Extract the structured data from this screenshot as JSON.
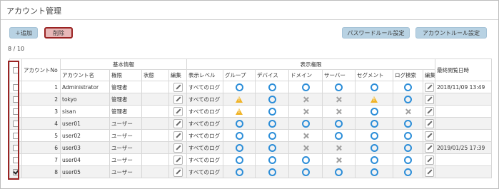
{
  "page": {
    "title": "アカウント管理"
  },
  "toolbar": {
    "add_label": "＋追加",
    "delete_label": "削除",
    "password_rule_label": "パスワードルール設定",
    "account_rule_label": "アカウントルール設定"
  },
  "selection_count": "8 / 10",
  "table": {
    "group_headers": {
      "account_no": "アカウントNo",
      "basic_info": "基本情報",
      "display_types": "表示権限",
      "last_viewed": "最終閲覧日時"
    },
    "columns": {
      "account_name": "アカウント名",
      "type": "権限",
      "status": "状態",
      "edit": "編集",
      "display_level": "表示レベル",
      "group": "グループ",
      "device": "デバイス",
      "domain": "ドメイン",
      "server": "サーバー",
      "segment": "セグメント",
      "log_search": "ログ検索",
      "edit2": "編集"
    },
    "rows": [
      {
        "no": "1",
        "name": "Administrator",
        "type": "管理者",
        "status": "",
        "level": "すべてのログ",
        "group": "circle",
        "device": "circle",
        "domain": "circle",
        "server": "circle",
        "segment": "circle",
        "log_search": "circle",
        "last_viewed": "2018/11/09 13:49",
        "checked": false
      },
      {
        "no": "2",
        "name": "tokyo",
        "type": "管理者",
        "status": "",
        "level": "すべてのログ",
        "group": "warn",
        "device": "circle",
        "domain": "cross",
        "server": "cross",
        "segment": "warn",
        "log_search": "circle",
        "last_viewed": "",
        "checked": false
      },
      {
        "no": "3",
        "name": "sisan",
        "type": "管理者",
        "status": "",
        "level": "すべてのログ",
        "group": "warn",
        "device": "circle",
        "domain": "cross",
        "server": "cross",
        "segment": "circle",
        "log_search": "cross",
        "last_viewed": "",
        "checked": false
      },
      {
        "no": "4",
        "name": "user01",
        "type": "ユーザー",
        "status": "",
        "level": "すべてのログ",
        "group": "circle",
        "device": "circle",
        "domain": "circle",
        "server": "circle",
        "segment": "circle",
        "log_search": "circle",
        "last_viewed": "",
        "checked": false
      },
      {
        "no": "5",
        "name": "user02",
        "type": "ユーザー",
        "status": "",
        "level": "すべてのログ",
        "group": "circle",
        "device": "circle",
        "domain": "cross",
        "server": "circle",
        "segment": "circle",
        "log_search": "circle",
        "last_viewed": "",
        "checked": false
      },
      {
        "no": "6",
        "name": "user03",
        "type": "ユーザー",
        "status": "",
        "level": "すべてのログ",
        "group": "circle",
        "device": "circle",
        "domain": "cross",
        "server": "cross",
        "segment": "circle",
        "log_search": "circle",
        "last_viewed": "2019/01/25 17:39",
        "checked": false
      },
      {
        "no": "7",
        "name": "user04",
        "type": "ユーザー",
        "status": "",
        "level": "すべてのログ",
        "group": "circle",
        "device": "circle",
        "domain": "circle",
        "server": "cross",
        "segment": "circle",
        "log_search": "circle",
        "last_viewed": "",
        "checked": false
      },
      {
        "no": "8",
        "name": "user05",
        "type": "ユーザー",
        "status": "",
        "level": "すべてのログ",
        "group": "circle",
        "device": "circle",
        "domain": "circle",
        "server": "circle",
        "segment": "circle",
        "log_search": "circle",
        "last_viewed": "",
        "checked": true
      }
    ]
  },
  "icons": {
    "edit": "pencil-icon",
    "circle": "circle-icon",
    "cross": "cross-icon",
    "warn": "warning-icon"
  },
  "colors": {
    "accent_button": "#b8d2e3",
    "delete_button": "#e8b8b8",
    "highlight_border": "#9a2323",
    "circle": "#2d8ed8",
    "warning": "#f0b428"
  }
}
